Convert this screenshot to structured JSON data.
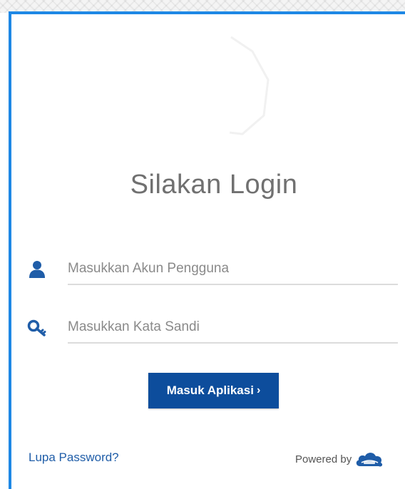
{
  "login": {
    "title": "Silakan Login",
    "username_placeholder": "Masukkan Akun Pengguna",
    "password_placeholder": "Masukkan Kata Sandi",
    "submit_label": "Masuk Aplikasi",
    "submit_chevron": "›",
    "forgot_label": "Lupa Password?",
    "powered_by": "Powered by"
  },
  "icons": {
    "user": "user-icon",
    "password": "key-icon",
    "brand": "cloud-logo-icon"
  },
  "colors": {
    "accent_border": "#1e88e5",
    "button": "#0d4d9c",
    "icon": "#1f5da8",
    "link": "#1f5da8",
    "title": "#707070"
  }
}
